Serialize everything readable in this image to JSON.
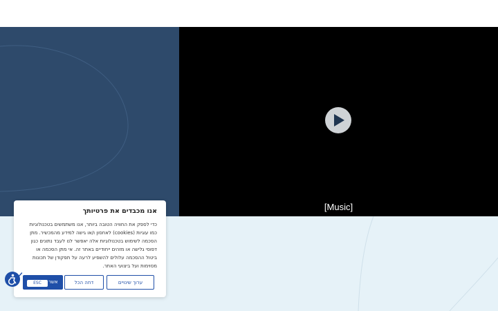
{
  "video": {
    "caption": "[Music]"
  },
  "consent": {
    "title": "אנו מכבדים את פרטיותך",
    "lines": [
      "כדי לספק את החוויה הטובה ביותר, אנו משתמשים בטכנולוגיות",
      "כמו עוגיות (cookies) לאחסון ו/או גישה למידע מהמכשיר. מתן",
      "הסכמה לשימוש בטכנולוגיות אלה יאפשר לנו לעבד נתונים כגון",
      "דפוסי גלישה או מזהים ייחודיים באתר זה. אי מתן הסכמה או",
      "ביטול ההסכמה עלולים להשפיע לרעה על תפקודן של תכונות",
      "מסוימות ועל ביצועי האתר."
    ],
    "customize_label": "ערוך שינויים",
    "reject_label": "דחה הכל",
    "accept_label": "אשר",
    "esc_label": "ESC"
  },
  "colors": {
    "hero": "#2e4a6b",
    "primary": "#1f4fa8",
    "background": "#e6f2f8"
  },
  "icons": {
    "play": "play-icon",
    "accessibility": "accessibility-icon"
  }
}
